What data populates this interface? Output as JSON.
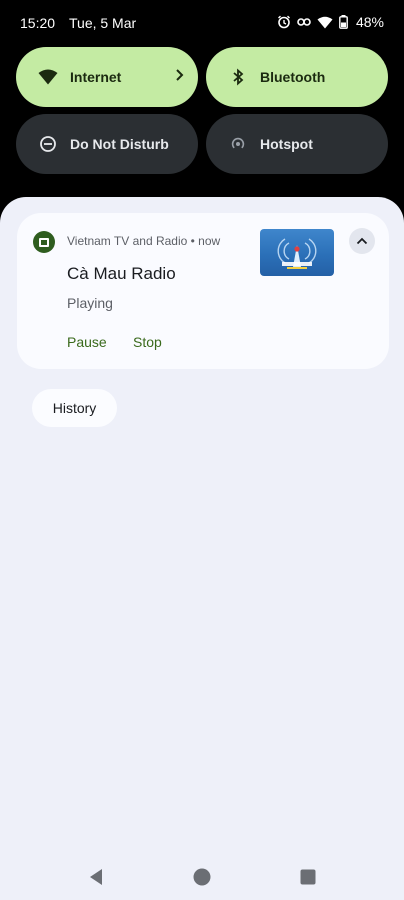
{
  "status_bar": {
    "time": "15:20",
    "date": "Tue, 5 Mar",
    "battery_text": "48%",
    "icons": [
      "alarm-icon",
      "link-icon",
      "wifi-icon",
      "battery-icon"
    ]
  },
  "quick_tiles": [
    {
      "label": "Internet",
      "state": "on",
      "icon": "wifi-icon",
      "has_chevron": true
    },
    {
      "label": "Bluetooth",
      "state": "on",
      "icon": "bluetooth-icon"
    },
    {
      "label": "Do Not Disturb",
      "state": "off",
      "icon": "do-not-disturb-icon"
    },
    {
      "label": "Hotspot",
      "state": "off",
      "icon": "hotspot-icon"
    }
  ],
  "notification": {
    "header": "Vietnam TV and Radio • now",
    "title": "Cà Mau Radio",
    "subtitle": "Playing",
    "actions": [
      "Pause",
      "Stop"
    ]
  },
  "history_button": "History",
  "colors": {
    "tile_on": "#c4eba3",
    "tile_off": "#2b2f33",
    "shade_bg": "#eef0f9",
    "action_text": "#3a6a1c"
  }
}
